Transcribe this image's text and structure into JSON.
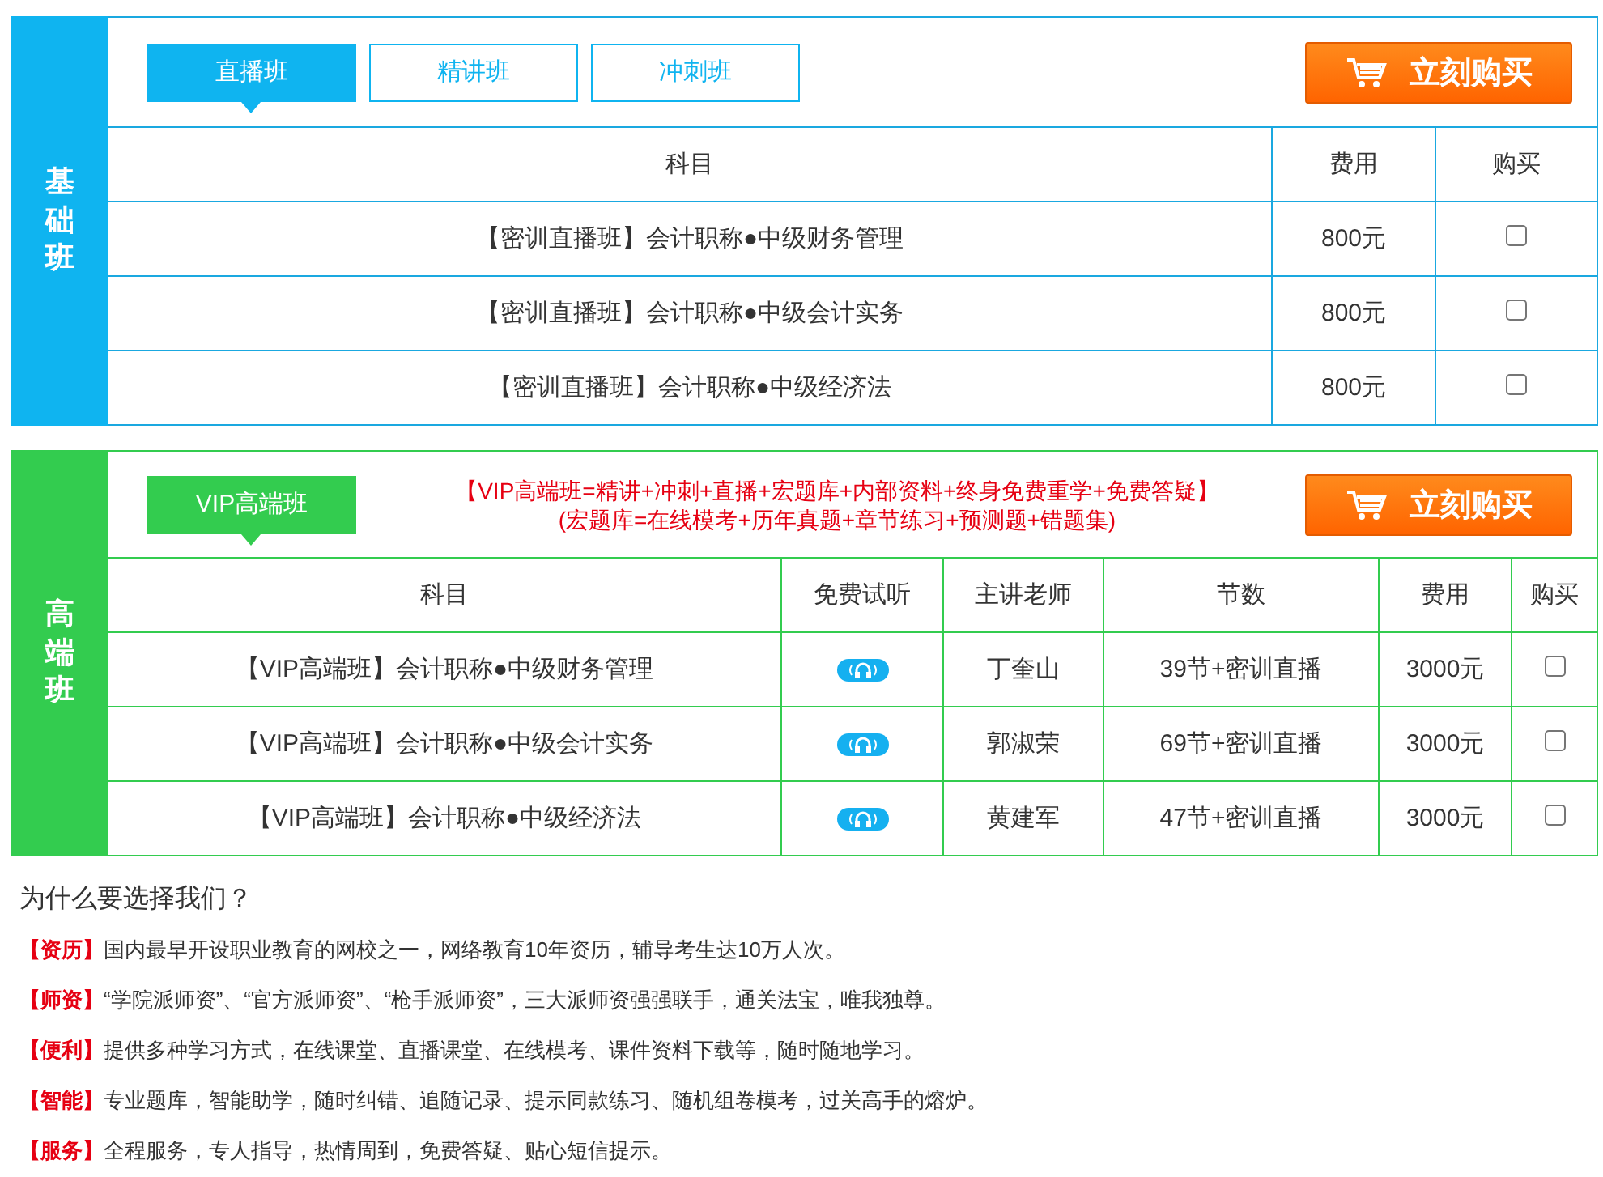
{
  "sections": [
    {
      "kind": "basic",
      "label": "基础班",
      "tabs": [
        {
          "label": "直播班",
          "selected": true
        },
        {
          "label": "精讲班",
          "selected": false
        },
        {
          "label": "冲刺班",
          "selected": false
        }
      ],
      "buy_button": "立刻购买",
      "columns": [
        "科目",
        "费用",
        "购买"
      ],
      "rows": [
        {
          "cells": [
            "【密训直播班】会计职称●中级财务管理",
            "800元"
          ],
          "checked": false
        },
        {
          "cells": [
            "【密训直播班】会计职称●中级会计实务",
            "800元"
          ],
          "checked": false
        },
        {
          "cells": [
            "【密训直播班】会计职称●中级经济法",
            "800元"
          ],
          "checked": false
        }
      ]
    },
    {
      "kind": "vip",
      "label": "高端班",
      "tabs": [
        {
          "label": "VIP高端班",
          "selected": true
        }
      ],
      "notes": [
        "【VIP高端班=精讲+冲刺+直播+宏题库+内部资料+终身免费重学+免费答疑】",
        "(宏题库=在线模考+历年真题+章节练习+预测题+错题集)"
      ],
      "buy_button": "立刻购买",
      "columns": [
        "科目",
        "免费试听",
        "主讲老师",
        "节数",
        "费用",
        "购买"
      ],
      "rows": [
        {
          "cells": [
            "【VIP高端班】会计职称●中级财务管理",
            "",
            "丁奎山",
            "39节+密训直播",
            "3000元"
          ],
          "checked": false
        },
        {
          "cells": [
            "【VIP高端班】会计职称●中级会计实务",
            "",
            "郭淑荣",
            "69节+密训直播",
            "3000元"
          ],
          "checked": false
        },
        {
          "cells": [
            "【VIP高端班】会计职称●中级经济法",
            "",
            "黄建军",
            "47节+密训直播",
            "3000元"
          ],
          "checked": false
        }
      ]
    }
  ],
  "why": {
    "title": "为什么要选择我们？",
    "items": [
      {
        "tag": "【资历】",
        "text": "国内最早开设职业教育的网校之一，网络教育10年资历，辅导考生达10万人次。"
      },
      {
        "tag": "【师资】",
        "text": "“学院派师资”、“官方派师资”、“枪手派师资”，三大派师资强强联手，通关法宝，唯我独尊。"
      },
      {
        "tag": "【便利】",
        "text": "提供多种学习方式，在线课堂、直播课堂、在线模考、课件资料下载等，随时随地学习。"
      },
      {
        "tag": "【智能】",
        "text": "专业题库，智能助学，随时纠错、追随记录、提示同款练习、随机组卷模考，过关高手的熔炉。"
      },
      {
        "tag": "【服务】",
        "text": "全程服务，专人指导，热情周到，免费答疑、贴心短信提示。"
      }
    ]
  }
}
